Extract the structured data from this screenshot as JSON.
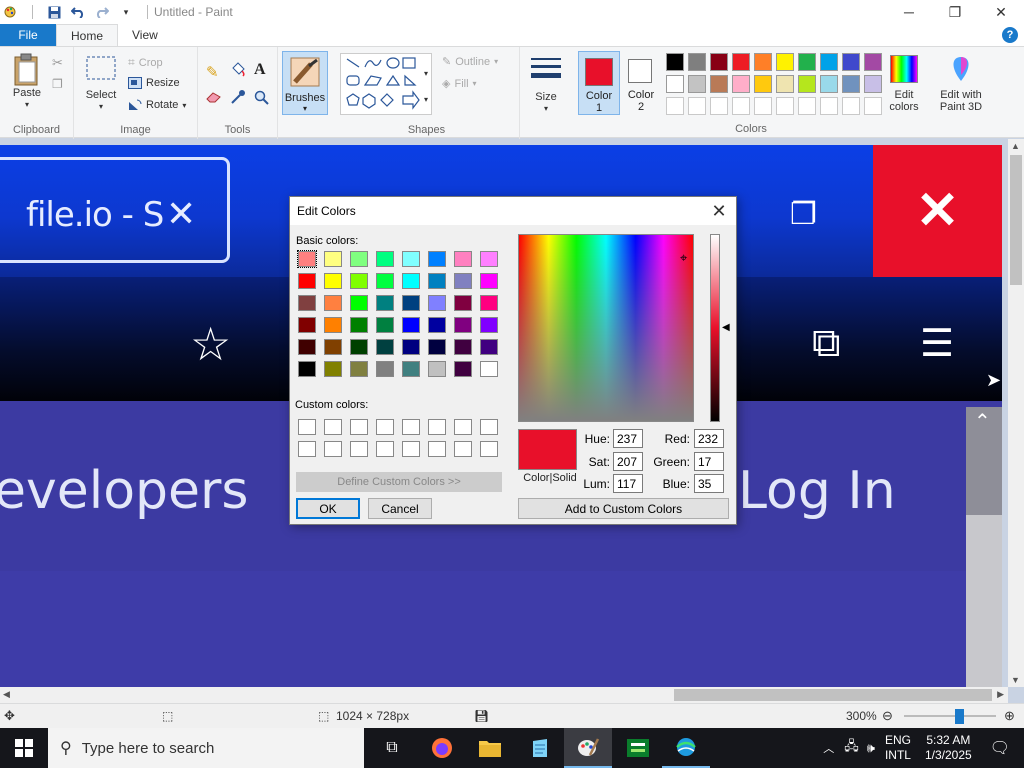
{
  "window": {
    "title": "Untitled - Paint",
    "minimize": "─",
    "maximize": "❐",
    "close": "✕"
  },
  "tabs": {
    "file": "File",
    "home": "Home",
    "view": "View",
    "help": "?"
  },
  "ribbon": {
    "clipboard": {
      "label": "Clipboard",
      "paste": "Paste"
    },
    "image": {
      "label": "Image",
      "select": "Select",
      "crop": "Crop",
      "resize": "Resize",
      "rotate": "Rotate"
    },
    "tools": {
      "label": "Tools"
    },
    "brushes": "Brushes",
    "shapes": {
      "label": "Shapes",
      "outline": "Outline",
      "fill": "Fill"
    },
    "size": "Size",
    "color1": {
      "label": "Color",
      "num": "1"
    },
    "color2": {
      "label": "Color",
      "num": "2"
    },
    "colors_label": "Colors",
    "edit_colors": {
      "l1": "Edit",
      "l2": "colors"
    },
    "paint3d": {
      "l1": "Edit with",
      "l2": "Paint 3D"
    }
  },
  "palette_row1": [
    "#000000",
    "#7f7f7f",
    "#880015",
    "#ed1c24",
    "#ff7f27",
    "#fff200",
    "#22b14c",
    "#00a2e8",
    "#3f48cc",
    "#a349a4"
  ],
  "palette_row2": [
    "#ffffff",
    "#c3c3c3",
    "#b97a57",
    "#ffaec9",
    "#ffc90e",
    "#efe4b0",
    "#b5e61d",
    "#99d9ea",
    "#7092be",
    "#c8bfe7"
  ],
  "accent": {
    "color1": "#e8102a",
    "color2": "#ffffff",
    "brushes_bg": "#c7dff5"
  },
  "canvas": {
    "tab_title": "file.io - S",
    "left_text": "evelopers",
    "right_text": "Log In"
  },
  "dialog": {
    "title": "Edit Colors",
    "basic_colors": "Basic colors:",
    "custom_colors": "Custom colors:",
    "define_custom": "Define Custom Colors >>",
    "ok": "OK",
    "cancel": "Cancel",
    "add_custom": "Add to Custom Colors",
    "color_solid": "Color|Solid",
    "hue_label": "Hue:",
    "hue": "237",
    "sat_label": "Sat:",
    "sat": "207",
    "lum_label": "Lum:",
    "lum": "117",
    "red_label": "Red:",
    "red": "232",
    "green_label": "Green:",
    "green": "17",
    "blue_label": "Blue:",
    "blue": "35",
    "preview_color": "#e8102a",
    "basic": [
      [
        "#ff8080",
        "#ffff80",
        "#80ff80",
        "#00ff80",
        "#80ffff",
        "#0080ff",
        "#ff80c0",
        "#ff80ff"
      ],
      [
        "#ff0000",
        "#ffff00",
        "#80ff00",
        "#00ff40",
        "#00ffff",
        "#0080c0",
        "#8080c0",
        "#ff00ff"
      ],
      [
        "#804040",
        "#ff8040",
        "#00ff00",
        "#008080",
        "#004080",
        "#8080ff",
        "#800040",
        "#ff0080"
      ],
      [
        "#800000",
        "#ff8000",
        "#008000",
        "#008040",
        "#0000ff",
        "#0000a0",
        "#800080",
        "#8000ff"
      ],
      [
        "#400000",
        "#804000",
        "#004000",
        "#004040",
        "#000080",
        "#000040",
        "#400040",
        "#400080"
      ],
      [
        "#000000",
        "#808000",
        "#808040",
        "#808080",
        "#408080",
        "#c0c0c0",
        "#400040",
        "#ffffff"
      ]
    ]
  },
  "status": {
    "dimensions": "1024 × 728px",
    "zoom": "300%"
  },
  "taskbar": {
    "search_placeholder": "Type here to search",
    "lang1": "ENG",
    "lang2": "INTL",
    "time": "5:32 AM",
    "date": "1/3/2025"
  }
}
